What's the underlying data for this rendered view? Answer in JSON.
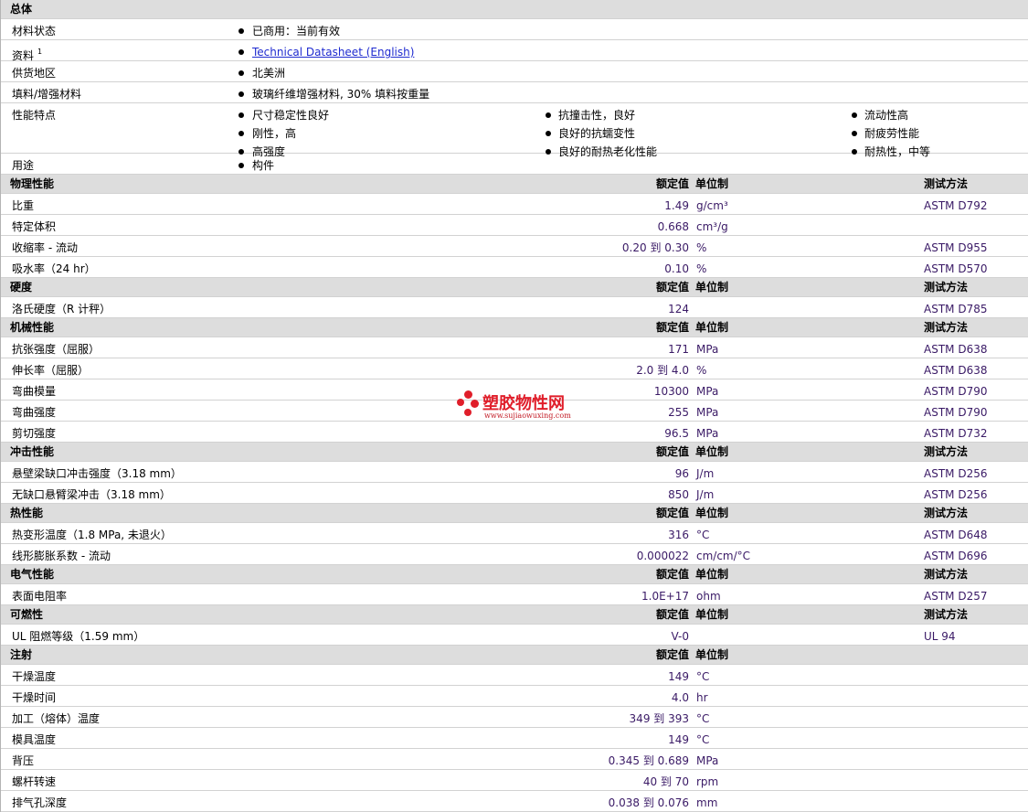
{
  "general": {
    "section_title": "总体",
    "status_label": "材料状态",
    "status_value": "已商用：当前有效",
    "docs_label": "资料",
    "docs_sup": "1",
    "docs_link": "Technical Datasheet (English)",
    "region_label": "供货地区",
    "region_value": "北美洲",
    "filler_label": "填料/增强材料",
    "filler_value": "玻璃纤维增强材料, 30% 填料按重量",
    "features_label": "性能特点",
    "features": [
      [
        "尺寸稳定性良好",
        "抗撞击性，良好",
        "流动性高"
      ],
      [
        "刚性，高",
        "良好的抗蠕变性",
        "耐疲劳性能"
      ],
      [
        "高强度",
        "良好的耐热老化性能",
        "耐热性，中等"
      ]
    ],
    "use_label": "用途",
    "use_value": "构件"
  },
  "headers": {
    "rated": "额定值",
    "unit": "单位制",
    "method": "测试方法"
  },
  "sections": [
    {
      "title": "物理性能",
      "rows": [
        {
          "label": "比重",
          "value": "1.49",
          "unit": "g/cm³",
          "method": "ASTM D792"
        },
        {
          "label": "特定体积",
          "value": "0.668",
          "unit": "cm³/g",
          "method": ""
        },
        {
          "label": "收缩率 - 流动",
          "value": "0.20 到 0.30",
          "unit": "%",
          "method": "ASTM D955"
        },
        {
          "label": "吸水率（24 hr）",
          "value": "0.10",
          "unit": "%",
          "method": "ASTM D570"
        }
      ]
    },
    {
      "title": "硬度",
      "rows": [
        {
          "label": "洛氏硬度（R 计秤）",
          "value": "124",
          "unit": "",
          "method": "ASTM D785"
        }
      ]
    },
    {
      "title": "机械性能",
      "rows": [
        {
          "label": "抗张强度（屈服）",
          "value": "171",
          "unit": "MPa",
          "method": "ASTM D638"
        },
        {
          "label": "伸长率（屈服）",
          "value": "2.0 到 4.0",
          "unit": "%",
          "method": "ASTM D638"
        },
        {
          "label": "弯曲模量",
          "value": "10300",
          "unit": "MPa",
          "method": "ASTM D790"
        },
        {
          "label": "弯曲强度",
          "value": "255",
          "unit": "MPa",
          "method": "ASTM D790"
        },
        {
          "label": "剪切强度",
          "value": "96.5",
          "unit": "MPa",
          "method": "ASTM D732"
        }
      ]
    },
    {
      "title": "冲击性能",
      "rows": [
        {
          "label": "悬壁梁缺口冲击强度（3.18 mm）",
          "value": "96",
          "unit": "J/m",
          "method": "ASTM D256"
        },
        {
          "label": "无缺口悬臂梁冲击（3.18 mm）",
          "value": "850",
          "unit": "J/m",
          "method": "ASTM D256"
        }
      ]
    },
    {
      "title": "热性能",
      "rows": [
        {
          "label": "热变形温度（1.8 MPa, 未退火）",
          "value": "316",
          "unit": "°C",
          "method": "ASTM D648"
        },
        {
          "label": "线形膨胀系数 - 流动",
          "value": "0.000022",
          "unit": "cm/cm/°C",
          "method": "ASTM D696"
        }
      ]
    },
    {
      "title": "电气性能",
      "rows": [
        {
          "label": "表面电阻率",
          "value": "1.0E+17",
          "unit": "ohm",
          "method": "ASTM D257"
        }
      ]
    },
    {
      "title": "可燃性",
      "rows": [
        {
          "label": "UL 阻燃等级（1.59 mm）",
          "value": "V-0",
          "unit": "",
          "method": "UL 94"
        }
      ]
    },
    {
      "title": "注射",
      "no_method": true,
      "rows": [
        {
          "label": "干燥温度",
          "value": "149",
          "unit": "°C",
          "method": ""
        },
        {
          "label": "干燥时间",
          "value": "4.0",
          "unit": "hr",
          "method": ""
        },
        {
          "label": "加工（熔体）温度",
          "value": "349 到 393",
          "unit": "°C",
          "method": ""
        },
        {
          "label": "模具温度",
          "value": "149",
          "unit": "°C",
          "method": ""
        },
        {
          "label": "背压",
          "value": "0.345 到 0.689",
          "unit": "MPa",
          "method": ""
        },
        {
          "label": "螺杆转速",
          "value": "40 到 70",
          "unit": "rpm",
          "method": ""
        },
        {
          "label": "排气孔深度",
          "value": "0.038 到 0.076",
          "unit": "mm",
          "method": ""
        }
      ]
    }
  ],
  "watermark": {
    "name": "塑胶物性网",
    "url": "www.sujiaowuxing.com",
    "color": "#e01e2a"
  }
}
